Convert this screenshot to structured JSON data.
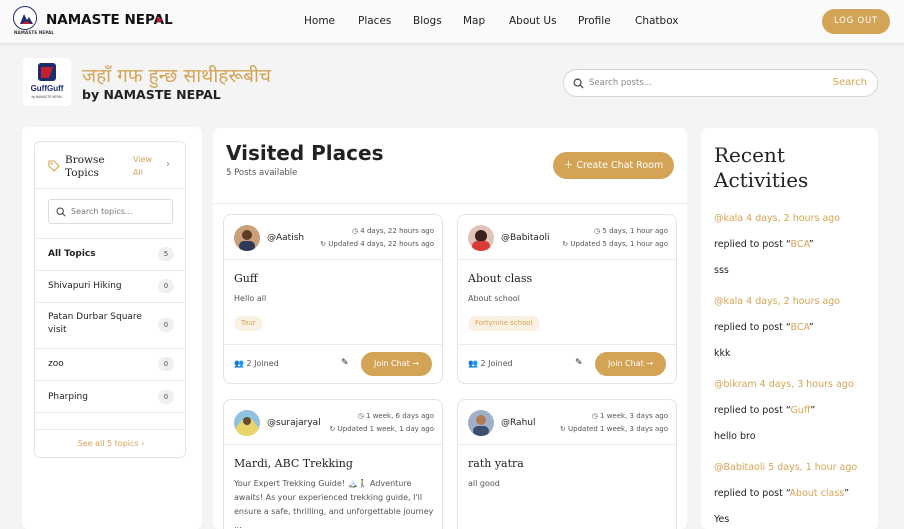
{
  "brand": {
    "name": "NAMASTE NEPAL",
    "small": "NAMASTE NEPAL"
  },
  "nav": {
    "items": [
      "Home",
      "Places",
      "Blogs",
      "Map",
      "About Us",
      "Profile",
      "Chatbox"
    ],
    "logout": "LOG OUT"
  },
  "hero": {
    "logo_text": "GuffGuff",
    "logo_sub": "by NAMASTE NEPAL",
    "title": "जहाँ गफ हुन्छ साथीहरूबीच",
    "subtitle": "by NAMASTE NEPAL"
  },
  "search": {
    "placeholder": "Search posts...",
    "button": "Search"
  },
  "topics": {
    "title_line1": "Browse",
    "title_line2": "Topics",
    "view_line1": "View",
    "view_line2": "All",
    "search_placeholder": "Search topics...",
    "items": [
      {
        "label": "All Topics",
        "count": "5"
      },
      {
        "label": "Shivapuri Hiking",
        "count": "0"
      },
      {
        "label": "Patan Durbar Square visit",
        "count": "0"
      },
      {
        "label": "zoo",
        "count": "0"
      },
      {
        "label": "Pharping",
        "count": "0"
      }
    ],
    "see_all": "See all 5 topics ›"
  },
  "main": {
    "title": "Visited Places",
    "subtitle": "5 Posts available",
    "create_button": "Create Chat Room"
  },
  "posts": [
    {
      "user": "@Aatish",
      "posted": "4 days, 22 hours ago",
      "updated": "Updated 4 days, 22 hours ago",
      "title": "Guff",
      "body": "Hello all",
      "tag": "Tour",
      "joined": "2 Joined",
      "join": "Join Chat"
    },
    {
      "user": "@Babitaoli",
      "posted": "5 days, 1 hour ago",
      "updated": "Updated 5 days, 1 hour ago",
      "title": "About class",
      "body": "About school",
      "tag": "Fortynine school",
      "joined": "2 Joined",
      "join": "Join Chat"
    },
    {
      "user": "@surajaryal",
      "posted": "1 week, 6 days ago",
      "updated": "Updated 1 week, 1 day ago",
      "title": "Mardi, ABC Trekking",
      "body": "Your Expert Trekking Guide! 🏔️🚶‍♂️ Adventure awaits! As your experienced trekking guide, I'll ensure a safe, thrilling, and unforgettable journey ..."
    },
    {
      "user": "@Rahul",
      "posted": "1 week, 3 days ago",
      "updated": "Updated 1 week, 3 days ago",
      "title": "rath yatra",
      "body": "all good"
    }
  ],
  "recent": {
    "title_line1": "Recent",
    "title_line2": "Activities",
    "items": [
      {
        "head": "@kala 4 days, 2 hours ago",
        "pre": "replied to post “",
        "post": "BCA",
        "suf": "”",
        "text": "sss"
      },
      {
        "head": "@kala 4 days, 2 hours ago",
        "pre": "replied to post “",
        "post": "BCA",
        "suf": "”",
        "text": "kkk"
      },
      {
        "head": "@bikram 4 days, 3 hours ago",
        "pre": "replied to post “",
        "post": "Guff",
        "suf": "”",
        "text": "hello bro"
      },
      {
        "head": "@Babitaoli 5 days, 1 hour ago",
        "pre": "replied to post “",
        "post": "About class",
        "suf": "”",
        "text": "Yes"
      }
    ]
  },
  "colors": {
    "accent": "#d4a456",
    "navy": "#1b2d6e",
    "red": "#c0202f"
  }
}
